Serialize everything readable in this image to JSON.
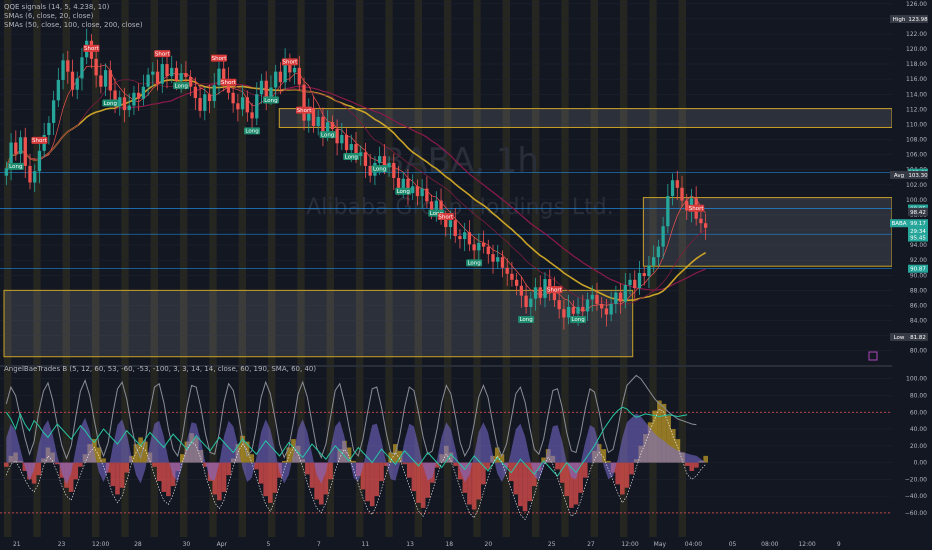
{
  "legend": {
    "line1": "QQE signals (14, 5, 4.238, 10)",
    "line2": "SMAs (6, close, 20, close)",
    "line3": "SMAs (50, close, 100, close, 200, close)",
    "osc": "AngelBaeTrades B (5, 12, 60, 53, -60, -53, -100, 3, 3, 14, 14, close, 60, 190, SMA, 60, 40)"
  },
  "watermark": {
    "symbol": "BABA, 1h",
    "name": "Alibaba Group Holdings Ltd."
  },
  "colors": {
    "up": "#26a69a",
    "down": "#ef5350",
    "sma50": "#c9a227",
    "sma200": "#8b1a4a",
    "zone": "#c9a227",
    "level": "#2196f3"
  },
  "chart_data": [
    {
      "type": "candlestick",
      "title": "BABA, 1h",
      "ylim": [
        78.5,
        126.5
      ],
      "yticks": [
        80.0,
        82.0,
        84.0,
        86.0,
        88.0,
        90.0,
        92.0,
        94.0,
        96.0,
        98.0,
        100.0,
        102.0,
        104.0,
        106.0,
        108.0,
        110.0,
        112.0,
        114.0,
        116.0,
        118.0,
        120.0,
        122.0,
        124.0,
        126.0
      ],
      "ytick_labels": [
        "80.00",
        "82.00",
        "84.00",
        "86.00",
        "88.00",
        "90.00",
        "92.00",
        "94.00",
        "96.00",
        "98.00",
        "100.00",
        "102.00",
        "104.00",
        "106.00",
        "108.00",
        "110.00",
        "112.00",
        "114.00",
        "116.00",
        "118.00",
        "120.00",
        "122.00",
        "124.00",
        "126.00"
      ],
      "x_labels": [
        "21",
        "23",
        "12:00",
        "28",
        "30",
        "Apr",
        "5",
        "7",
        "11",
        "13",
        "18",
        "20",
        "25",
        "27",
        "12:00",
        "May",
        "04:00",
        "05",
        "08:00",
        "12:00",
        "9"
      ],
      "x_label_fractions": [
        0.018,
        0.066,
        0.108,
        0.148,
        0.2,
        0.238,
        0.288,
        0.342,
        0.392,
        0.44,
        0.482,
        0.524,
        0.592,
        0.634,
        0.676,
        0.708,
        0.744,
        0.786,
        0.826,
        0.866,
        0.9
      ],
      "close": [
        104.2,
        107.6,
        106.1,
        108.3,
        104.5,
        102.3,
        103.8,
        106.5,
        108.6,
        110.2,
        113.2,
        115.9,
        118.5,
        117.0,
        114.6,
        116.1,
        118.9,
        121.1,
        118.7,
        116.5,
        115.0,
        117.2,
        114.5,
        112.4,
        113.6,
        111.9,
        112.5,
        114.2,
        113.4,
        115.0,
        116.6,
        117.0,
        115.4,
        118.0,
        116.4,
        117.5,
        115.8,
        116.8,
        116.3,
        115.0,
        113.5,
        111.8,
        114.0,
        113.1,
        115.2,
        117.4,
        116.0,
        114.2,
        112.8,
        112.0,
        113.6,
        111.6,
        110.8,
        114.0,
        115.8,
        113.5,
        114.9,
        117.0,
        115.6,
        118.5,
        116.9,
        117.5,
        115.3,
        110.5,
        112.2,
        109.8,
        111.0,
        108.7,
        110.3,
        109.4,
        107.5,
        108.6,
        106.6,
        107.4,
        105.8,
        106.3,
        104.5,
        103.2,
        104.9,
        105.8,
        104.3,
        104.9,
        102.9,
        101.5,
        102.8,
        100.9,
        101.8,
        100.5,
        101.5,
        99.8,
        98.7,
        99.9,
        97.6,
        96.4,
        97.3,
        95.2,
        94.8,
        95.7,
        94.1,
        93.3,
        94.3,
        93.8,
        92.8,
        91.8,
        92.4,
        91.0,
        90.2,
        89.4,
        88.6,
        87.3,
        85.8,
        86.9,
        88.4,
        87.0,
        89.5,
        88.2,
        86.7,
        85.5,
        84.4,
        85.8,
        84.9,
        85.8,
        85.2,
        86.8,
        87.4,
        86.2,
        85.6,
        84.8,
        86.2,
        87.7,
        86.5,
        88.7,
        89.4,
        88.3,
        90.3,
        89.9,
        91.3,
        92.4,
        93.8,
        96.5,
        100.5,
        102.6,
        101.6,
        99.9,
        98.6,
        100.2,
        97.5,
        96.9,
        96.3
      ],
      "highlight": {
        "High": 123.98,
        "Low": 81.82,
        "Last": 99.17,
        "Avg": 103.3
      },
      "price_tags": [
        {
          "label": "High",
          "value": "123.98",
          "y": 123.98,
          "color": "#363a45"
        },
        {
          "label": "",
          "value": "103.60",
          "y": 103.6,
          "color": "#26a69a"
        },
        {
          "label": "Avg",
          "value": "103.30",
          "y": 103.3,
          "color": "#363a45"
        },
        {
          "label": "",
          "value": "98.85",
          "y": 98.85,
          "color": "#26a69a"
        },
        {
          "label": "",
          "value": "98.42",
          "y": 98.42,
          "color": "#363a45"
        },
        {
          "label": "BABA",
          "value": "99.17",
          "y": 96.9,
          "color": "#26a69a"
        },
        {
          "label": "",
          "value": "29:34",
          "y": 95.9,
          "color": "#26a69a"
        },
        {
          "label": "",
          "value": "95.45",
          "y": 95.0,
          "color": "#26a69a"
        },
        {
          "label": "",
          "value": "90.87",
          "y": 90.87,
          "color": "#26a69a"
        },
        {
          "label": "Low",
          "value": "81.82",
          "y": 81.82,
          "color": "#363a45"
        }
      ],
      "zones": [
        {
          "y1": 109.6,
          "y2": 112.1,
          "x1f": 0.31,
          "x2f": 1.0
        },
        {
          "y1": 91.2,
          "y2": 100.3,
          "x1f": 0.72,
          "x2f": 1.0
        },
        {
          "y1": 79.2,
          "y2": 88.0,
          "x1f": 0.0,
          "x2f": 0.708
        }
      ],
      "levels": [
        103.6,
        98.85,
        95.45,
        90.87
      ],
      "signals": [
        {
          "i": 2,
          "text": "Long",
          "dir": "long"
        },
        {
          "i": 7,
          "text": "Short",
          "dir": "short"
        },
        {
          "i": 18,
          "text": "Short",
          "dir": "short"
        },
        {
          "i": 22,
          "text": "Long",
          "dir": "long"
        },
        {
          "i": 33,
          "text": "Short",
          "dir": "short"
        },
        {
          "i": 37,
          "text": "Long",
          "dir": "long"
        },
        {
          "i": 45,
          "text": "Short",
          "dir": "short"
        },
        {
          "i": 47,
          "text": "Short",
          "dir": "short"
        },
        {
          "i": 52,
          "text": "Long",
          "dir": "long"
        },
        {
          "i": 56,
          "text": "Long",
          "dir": "long"
        },
        {
          "i": 60,
          "text": "Short",
          "dir": "short"
        },
        {
          "i": 63,
          "text": "Short",
          "dir": "short"
        },
        {
          "i": 68,
          "text": "Long",
          "dir": "long"
        },
        {
          "i": 73,
          "text": "Long",
          "dir": "long"
        },
        {
          "i": 79,
          "text": "Long",
          "dir": "long"
        },
        {
          "i": 84,
          "text": "Long",
          "dir": "long"
        },
        {
          "i": 91,
          "text": "Long",
          "dir": "long"
        },
        {
          "i": 93,
          "text": "Short",
          "dir": "short"
        },
        {
          "i": 99,
          "text": "Long",
          "dir": "long"
        },
        {
          "i": 110,
          "text": "Long",
          "dir": "long"
        },
        {
          "i": 116,
          "text": "Short",
          "dir": "short"
        },
        {
          "i": 121,
          "text": "Long",
          "dir": "long"
        },
        {
          "i": 146,
          "text": "Short",
          "dir": "short"
        }
      ]
    },
    {
      "type": "area",
      "title": "AngelBaeTrades B",
      "ylim": [
        -78,
        108
      ],
      "yticks": [
        100,
        80,
        60,
        40,
        20,
        0,
        -20,
        -40,
        -60
      ],
      "ytick_labels": [
        "100.00",
        "80.00",
        "60.00",
        "40.00",
        "20.00",
        "0.00",
        "−20.00",
        "−40.00",
        "−60.00"
      ],
      "hlines": [
        60,
        -60
      ],
      "series": [
        {
          "name": "",
          "values": [
            -5,
            8,
            12,
            2,
            -10,
            -20,
            -25,
            -15,
            5,
            18,
            12,
            -2,
            -18,
            -30,
            -35,
            -20,
            -5,
            10,
            22,
            28,
            18,
            5,
            -12,
            -28,
            -38,
            -30,
            -12,
            8,
            22,
            30,
            25,
            12,
            -5,
            -22,
            -35,
            -40,
            -28,
            -10,
            10,
            25,
            35,
            30,
            15,
            -5,
            -22,
            -38,
            -45,
            -35,
            -15,
            5,
            22,
            32,
            25,
            10,
            -8,
            -25,
            -40,
            -48,
            -36,
            -18,
            2,
            18,
            28,
            20,
            4,
            -14,
            -30,
            -44,
            -50,
            -38,
            -20,
            0,
            16,
            26,
            18,
            2,
            -16,
            -32,
            -46,
            -52,
            -40,
            -22,
            -4,
            12,
            22,
            14,
            -2,
            -18,
            -34,
            -48,
            -54,
            -42,
            -24,
            -6,
            10,
            20,
            12,
            -4,
            -20,
            -36,
            -50,
            -56,
            -44,
            -26,
            -8,
            8,
            18,
            10,
            -6,
            -22,
            -38,
            -52,
            -58,
            -46,
            -28,
            -10,
            6,
            16,
            8,
            -8,
            -24,
            -40,
            -54,
            -50,
            -36,
            -18,
            0,
            14,
            22,
            16,
            2,
            -12,
            -26,
            -38,
            -30,
            -14,
            4,
            20,
            34,
            48,
            62,
            74,
            70,
            56,
            40,
            28,
            12,
            -4,
            -10,
            -6,
            2,
            8
          ]
        },
        {
          "name": "",
          "values": [
            60,
            52,
            40,
            58,
            46,
            38,
            50,
            44,
            36,
            30,
            38,
            46,
            40,
            34,
            28,
            36,
            44,
            38,
            30,
            24,
            32,
            40,
            34,
            28,
            22,
            30,
            38,
            32,
            26,
            20,
            28,
            36,
            30,
            24,
            18,
            26,
            34,
            28,
            22,
            16,
            24,
            32,
            26,
            20,
            14,
            22,
            30,
            24,
            18,
            12,
            20,
            28,
            22,
            16,
            10,
            18,
            26,
            20,
            14,
            8,
            16,
            24,
            18,
            12,
            6,
            14,
            22,
            16,
            10,
            4,
            12,
            20,
            14,
            8,
            2,
            10,
            18,
            12,
            6,
            0,
            8,
            16,
            10,
            4,
            -2,
            6,
            14,
            8,
            2,
            -4,
            4,
            12,
            6,
            0,
            -6,
            2,
            10,
            4,
            -2,
            -8,
            0,
            8,
            2,
            -4,
            -10,
            -2,
            6,
            0,
            -6,
            -12,
            -4,
            4,
            -2,
            -8,
            -14,
            -6,
            2,
            -4,
            -10,
            -16,
            -8,
            0,
            -6,
            -12,
            -4,
            4,
            12,
            20,
            30,
            40,
            48,
            56,
            62,
            66,
            64,
            58,
            54,
            56,
            58,
            57,
            56,
            55,
            56,
            57,
            56,
            55,
            56,
            57
          ]
        },
        {
          "name": "",
          "values": [
            70,
            90,
            80,
            55,
            30,
            10,
            25,
            60,
            85,
            95,
            75,
            45,
            20,
            5,
            20,
            55,
            85,
            98,
            80,
            50,
            22,
            8,
            24,
            58,
            88,
            96,
            76,
            44,
            18,
            6,
            26,
            62,
            90,
            94,
            72,
            40,
            16,
            8,
            30,
            66,
            92,
            90,
            66,
            34,
            12,
            10,
            36,
            72,
            94,
            86,
            60,
            28,
            8,
            14,
            42,
            78,
            96,
            82,
            54,
            22,
            6,
            18,
            48,
            82,
            96,
            78,
            48,
            18,
            6,
            22,
            54,
            86,
            94,
            72,
            42,
            14,
            8,
            28,
            60,
            88,
            90,
            66,
            36,
            12,
            10,
            34,
            66,
            90,
            86,
            60,
            30,
            10,
            14,
            40,
            72,
            92,
            82,
            54,
            24,
            8,
            18,
            46,
            78,
            92,
            78,
            48,
            20,
            8,
            22,
            52,
            82,
            90,
            72,
            42,
            16,
            10,
            28,
            58,
            86,
            88,
            66,
            36,
            14,
            12,
            34,
            64,
            88,
            84,
            60,
            30,
            12,
            16,
            40,
            70,
            92,
            98,
            104,
            100,
            92,
            84,
            76,
            70,
            66,
            60,
            56,
            52,
            50,
            48,
            46,
            45
          ]
        }
      ]
    }
  ]
}
